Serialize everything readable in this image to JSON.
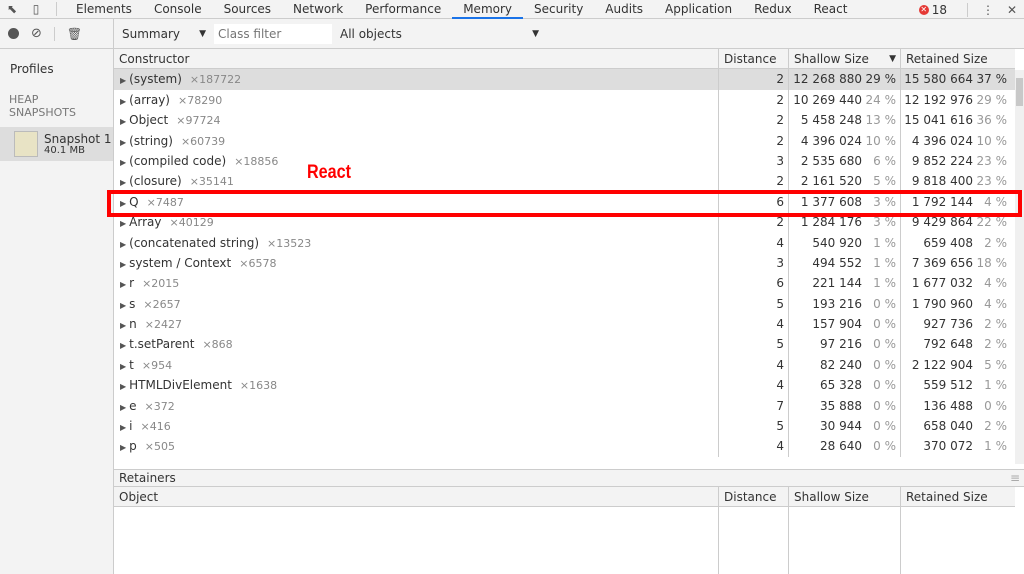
{
  "tabs": [
    "Elements",
    "Console",
    "Sources",
    "Network",
    "Performance",
    "Memory",
    "Security",
    "Audits",
    "Application",
    "Redux",
    "React"
  ],
  "active_tab": "Memory",
  "error_count": "18",
  "toolbar": {
    "view": "Summary",
    "class_filter_placeholder": "Class filter",
    "objects": "All objects"
  },
  "sidebar": {
    "title": "Profiles",
    "section": "HEAP SNAPSHOTS",
    "snapshot_name": "Snapshot 1",
    "snapshot_size": "40.1 MB"
  },
  "table": {
    "headers": [
      "Constructor",
      "Distance",
      "Shallow Size",
      "Retained Size"
    ],
    "rows": [
      {
        "name": "(system)",
        "count": "×187722",
        "distance": "2",
        "shallow": "12 268 880",
        "shallow_pct": "29 %",
        "retained": "15 580 664",
        "retained_pct": "37 %"
      },
      {
        "name": "(array)",
        "count": "×78290",
        "distance": "2",
        "shallow": "10 269 440",
        "shallow_pct": "24 %",
        "retained": "12 192 976",
        "retained_pct": "29 %"
      },
      {
        "name": "Object",
        "count": "×97724",
        "distance": "2",
        "shallow": "5 458 248",
        "shallow_pct": "13 %",
        "retained": "15 041 616",
        "retained_pct": "36 %"
      },
      {
        "name": "(string)",
        "count": "×60739",
        "distance": "2",
        "shallow": "4 396 024",
        "shallow_pct": "10 %",
        "retained": "4 396 024",
        "retained_pct": "10 %"
      },
      {
        "name": "(compiled code)",
        "count": "×18856",
        "distance": "3",
        "shallow": "2 535 680",
        "shallow_pct": "6 %",
        "retained": "9 852 224",
        "retained_pct": "23 %"
      },
      {
        "name": "(closure)",
        "count": "×35141",
        "distance": "2",
        "shallow": "2 161 520",
        "shallow_pct": "5 %",
        "retained": "9 818 400",
        "retained_pct": "23 %"
      },
      {
        "name": "Q",
        "count": "×7487",
        "distance": "6",
        "shallow": "1 377 608",
        "shallow_pct": "3 %",
        "retained": "1 792 144",
        "retained_pct": "4 %"
      },
      {
        "name": "Array",
        "count": "×40129",
        "distance": "2",
        "shallow": "1 284 176",
        "shallow_pct": "3 %",
        "retained": "9 429 864",
        "retained_pct": "22 %"
      },
      {
        "name": "(concatenated string)",
        "count": "×13523",
        "distance": "4",
        "shallow": "540 920",
        "shallow_pct": "1 %",
        "retained": "659 408",
        "retained_pct": "2 %"
      },
      {
        "name": "system / Context",
        "count": "×6578",
        "distance": "3",
        "shallow": "494 552",
        "shallow_pct": "1 %",
        "retained": "7 369 656",
        "retained_pct": "18 %"
      },
      {
        "name": "r",
        "count": "×2015",
        "distance": "6",
        "shallow": "221 144",
        "shallow_pct": "1 %",
        "retained": "1 677 032",
        "retained_pct": "4 %"
      },
      {
        "name": "s",
        "count": "×2657",
        "distance": "5",
        "shallow": "193 216",
        "shallow_pct": "0 %",
        "retained": "1 790 960",
        "retained_pct": "4 %"
      },
      {
        "name": "n",
        "count": "×2427",
        "distance": "4",
        "shallow": "157 904",
        "shallow_pct": "0 %",
        "retained": "927 736",
        "retained_pct": "2 %"
      },
      {
        "name": "t.setParent",
        "count": "×868",
        "distance": "5",
        "shallow": "97 216",
        "shallow_pct": "0 %",
        "retained": "792 648",
        "retained_pct": "2 %"
      },
      {
        "name": "t",
        "count": "×954",
        "distance": "4",
        "shallow": "82 240",
        "shallow_pct": "0 %",
        "retained": "2 122 904",
        "retained_pct": "5 %"
      },
      {
        "name": "HTMLDivElement",
        "count": "×1638",
        "distance": "4",
        "shallow": "65 328",
        "shallow_pct": "0 %",
        "retained": "559 512",
        "retained_pct": "1 %"
      },
      {
        "name": "e",
        "count": "×372",
        "distance": "7",
        "shallow": "35 888",
        "shallow_pct": "0 %",
        "retained": "136 488",
        "retained_pct": "0 %"
      },
      {
        "name": "i",
        "count": "×416",
        "distance": "5",
        "shallow": "30 944",
        "shallow_pct": "0 %",
        "retained": "658 040",
        "retained_pct": "2 %"
      },
      {
        "name": "p",
        "count": "×505",
        "distance": "4",
        "shallow": "28 640",
        "shallow_pct": "0 %",
        "retained": "370 072",
        "retained_pct": "1 %"
      }
    ]
  },
  "retainers": {
    "title": "Retainers",
    "headers": [
      "Object",
      "Distance",
      "Shallow Size",
      "Retained Size"
    ]
  },
  "annotation": {
    "label": "React",
    "color": "#ff0000"
  }
}
